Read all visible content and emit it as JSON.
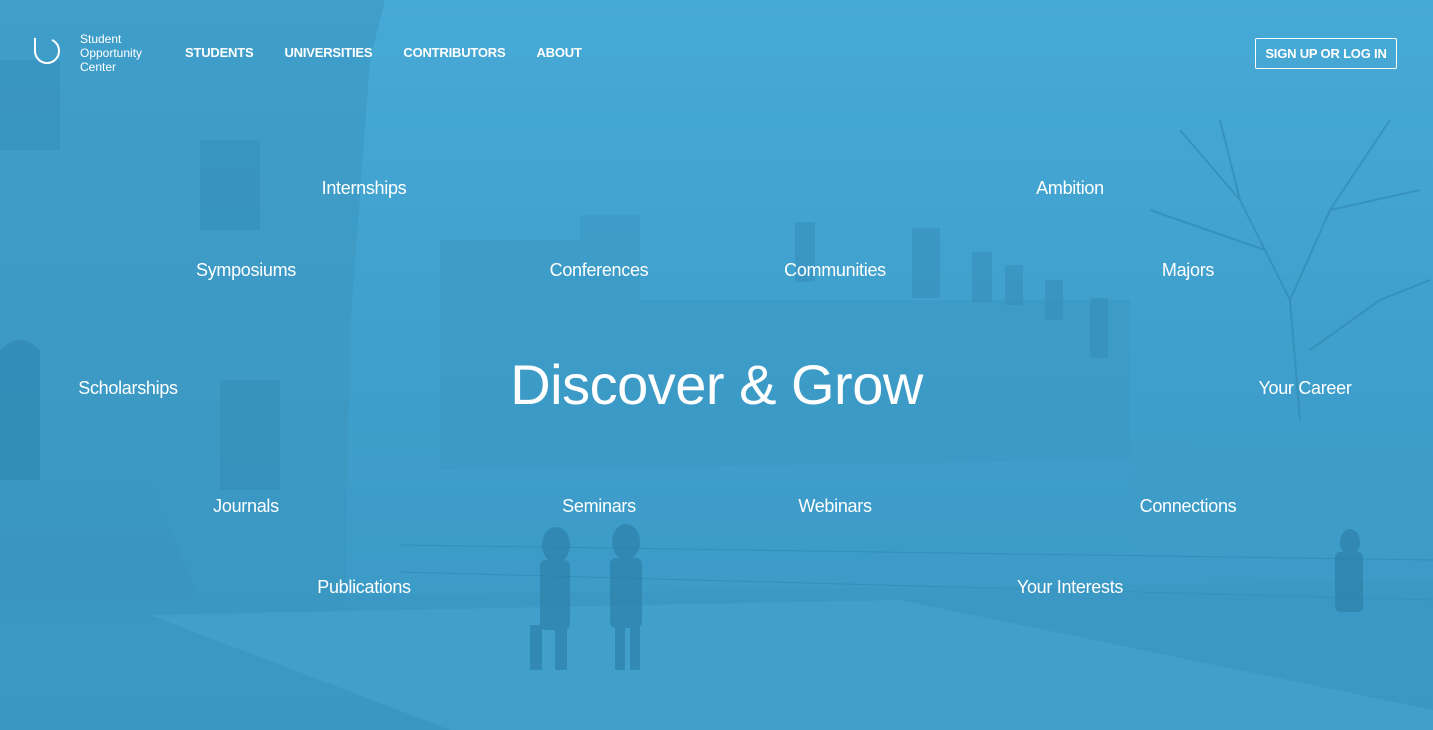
{
  "brand": {
    "logo_icon": "u-ring-icon",
    "name": "Student\nOpportunity\nCenter"
  },
  "nav": {
    "items": [
      {
        "label": "STUDENTS"
      },
      {
        "label": "UNIVERSITIES"
      },
      {
        "label": "CONTRIBUTORS"
      },
      {
        "label": "ABOUT"
      }
    ],
    "signup_label": "SIGN UP OR LOG IN"
  },
  "hero": {
    "headline": "Discover & Grow",
    "words": {
      "internships": "Internships",
      "ambition": "Ambition",
      "symposiums": "Symposiums",
      "conferences": "Conferences",
      "communities": "Communities",
      "majors": "Majors",
      "scholarships": "Scholarships",
      "your_career": "Your Career",
      "journals": "Journals",
      "seminars": "Seminars",
      "webinars": "Webinars",
      "connections": "Connections",
      "publications": "Publications",
      "your_interests": "Your Interests"
    }
  },
  "colors": {
    "overlay": "#45a6d3",
    "text": "#ffffff"
  }
}
